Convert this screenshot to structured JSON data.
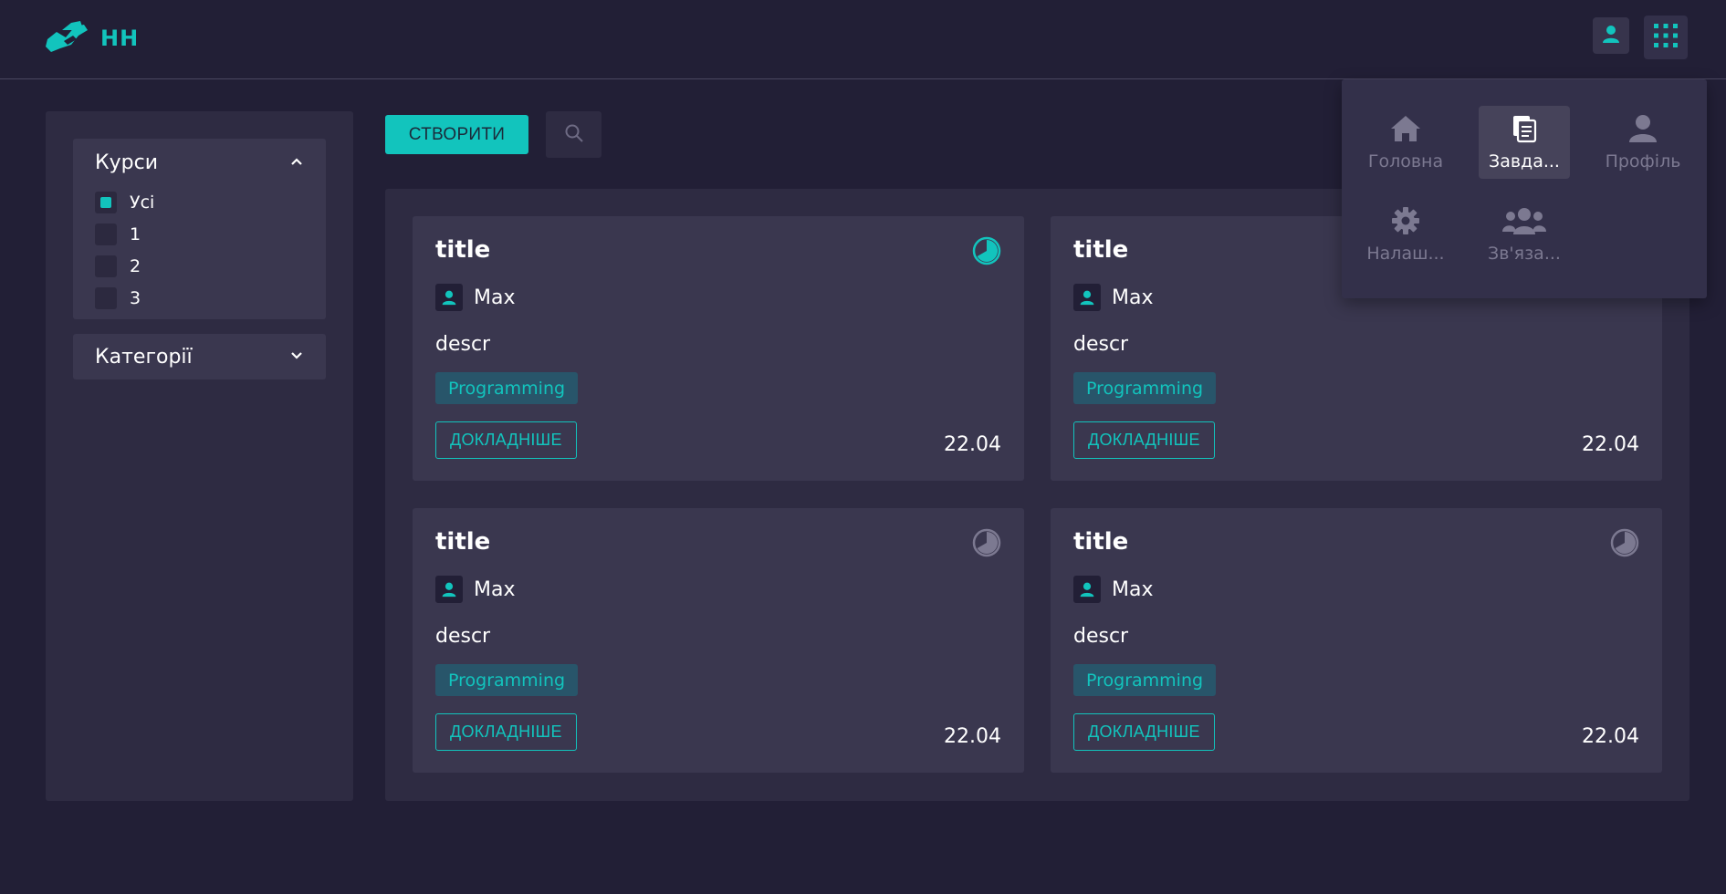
{
  "header": {
    "logo_text": "HH",
    "profile_icon": "user-icon",
    "apps_icon": "grid-icon"
  },
  "sidebar": {
    "courses": {
      "title": "Курси",
      "expanded": true,
      "options": [
        {
          "label": "Усі",
          "checked": true
        },
        {
          "label": "1",
          "checked": false
        },
        {
          "label": "2",
          "checked": false
        },
        {
          "label": "3",
          "checked": false
        }
      ]
    },
    "categories": {
      "title": "Категорії",
      "expanded": false
    }
  },
  "toolbar": {
    "create_label": "СТВОРИТИ",
    "search_icon": "search-icon"
  },
  "cards": [
    {
      "title": "title",
      "author": "Max",
      "descr": "descr",
      "tag": "Programming",
      "more_label": "ДОКЛАДНІШЕ",
      "date": "22.04",
      "progress_active": true
    },
    {
      "title": "title",
      "author": "Max",
      "descr": "descr",
      "tag": "Programming",
      "more_label": "ДОКЛАДНІШЕ",
      "date": "22.04",
      "progress_active": false
    },
    {
      "title": "title",
      "author": "Max",
      "descr": "descr",
      "tag": "Programming",
      "more_label": "ДОКЛАДНІШЕ",
      "date": "22.04",
      "progress_active": false
    },
    {
      "title": "title",
      "author": "Max",
      "descr": "descr",
      "tag": "Programming",
      "more_label": "ДОКЛАДНІШЕ",
      "date": "22.04",
      "progress_active": false
    }
  ],
  "apps_menu": {
    "items": [
      {
        "label": "Головна",
        "icon": "home-icon",
        "active": false
      },
      {
        "label": "Завда...",
        "icon": "tasks-icon",
        "active": true
      },
      {
        "label": "Профіль",
        "icon": "user-icon",
        "active": false
      },
      {
        "label": "Налаш...",
        "icon": "gear-icon",
        "active": false
      },
      {
        "label": "Зв'яза...",
        "icon": "users-icon",
        "active": false
      }
    ]
  },
  "colors": {
    "accent": "#12c4bd",
    "background": "#221f36",
    "panel": "#2e2b42",
    "card": "#3a374f"
  }
}
